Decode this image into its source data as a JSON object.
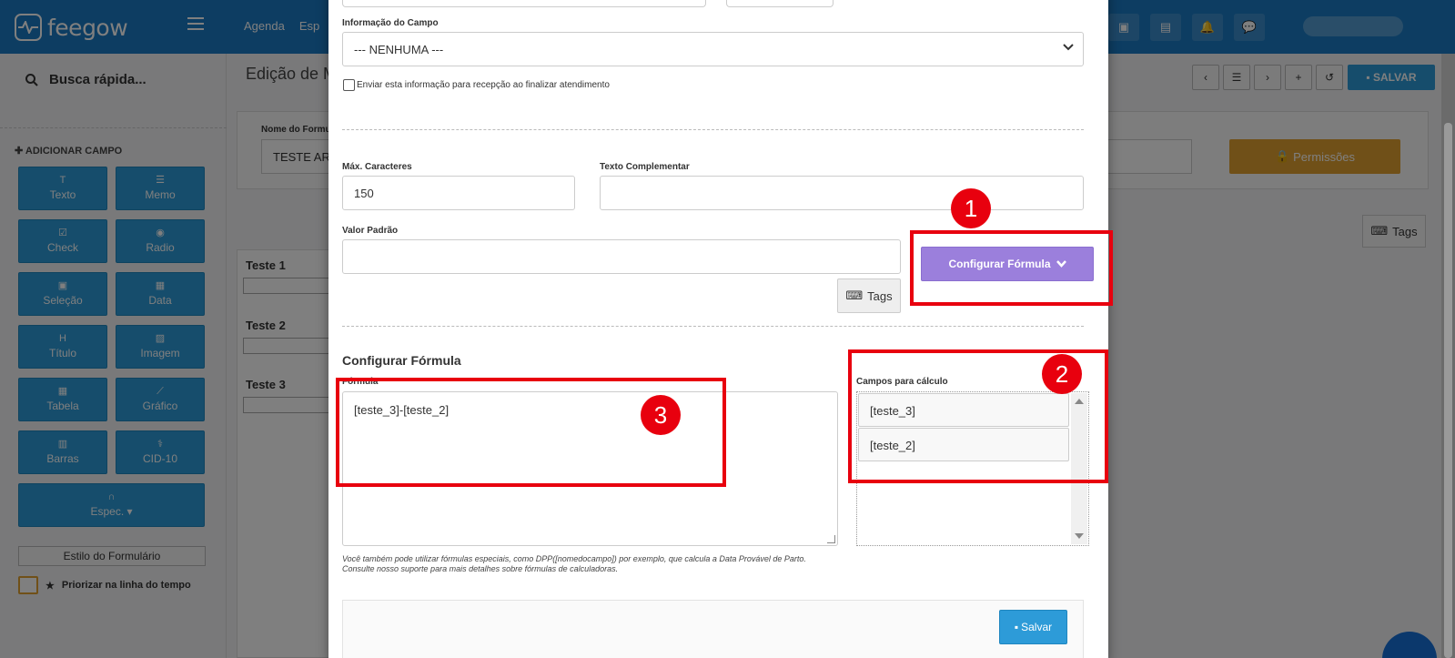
{
  "app": {
    "logo_text": "feegow",
    "nav": [
      "Agenda",
      "Esp"
    ],
    "quick_search": "Busca rápida...",
    "add_field_label": "ADICIONAR CAMPO",
    "field_types": [
      {
        "label": "Texto",
        "icon": "text-icon"
      },
      {
        "label": "Memo",
        "icon": "memo-icon"
      },
      {
        "label": "Check",
        "icon": "check-icon"
      },
      {
        "label": "Radio",
        "icon": "radio-icon"
      },
      {
        "label": "Seleção",
        "icon": "select-icon"
      },
      {
        "label": "Data",
        "icon": "calendar-icon"
      },
      {
        "label": "Título",
        "icon": "heading-icon"
      },
      {
        "label": "Imagem",
        "icon": "image-icon"
      },
      {
        "label": "Tabela",
        "icon": "table-icon"
      },
      {
        "label": "Gráfico",
        "icon": "chart-icon"
      },
      {
        "label": "Barras",
        "icon": "barcode-icon"
      },
      {
        "label": "CID-10",
        "icon": "stethoscope-icon"
      }
    ],
    "espec_label": "Espec.",
    "form_style_label": "Estilo do Formulário",
    "prioritize_label": "Priorizar na linha do tempo",
    "page_title": "Edição de M",
    "save_top_label": "SALVAR",
    "form_name_label": "Nome do Formu",
    "form_name_value": "TESTE AR",
    "permissions_label": "Permissões",
    "tags_label": "Tags",
    "tests": [
      "Teste 1",
      "Teste 2",
      "Teste 3"
    ]
  },
  "modal": {
    "field_info_label": "Informação do Campo",
    "field_info_value": "--- NENHUMA ---",
    "send_reception_label": "Enviar esta informação para recepção ao finalizar atendimento",
    "max_chars_label": "Máx. Caracteres",
    "max_chars_value": "150",
    "extra_text_label": "Texto Complementar",
    "default_value_label": "Valor Padrão",
    "tags_label": "Tags",
    "config_formula_button": "Configurar Fórmula",
    "section_title": "Configurar Fórmula",
    "formula_label": "Fórmula",
    "formula_value": "[teste_3]-[teste_2]",
    "calc_fields_label": "Campos para cálculo",
    "calc_fields": [
      "[teste_3]",
      "[teste_2]"
    ],
    "hint_line1": "Você também pode utilizar fórmulas especiais, como DPP([nomedocampo]) por exemplo, que calcula a Data Provável de Parto.",
    "hint_line2": "Consulte nosso suporte para mais detalhes sobre fórmulas de calculadoras.",
    "save_label": "Salvar"
  },
  "annotations": [
    "1",
    "2",
    "3"
  ],
  "colors": {
    "topbar": "#1b7bc4",
    "field_button": "#2d9bd8",
    "config_button": "#9b7fdc",
    "permissions": "#e0a030",
    "annotation_red": "#e8000e"
  }
}
